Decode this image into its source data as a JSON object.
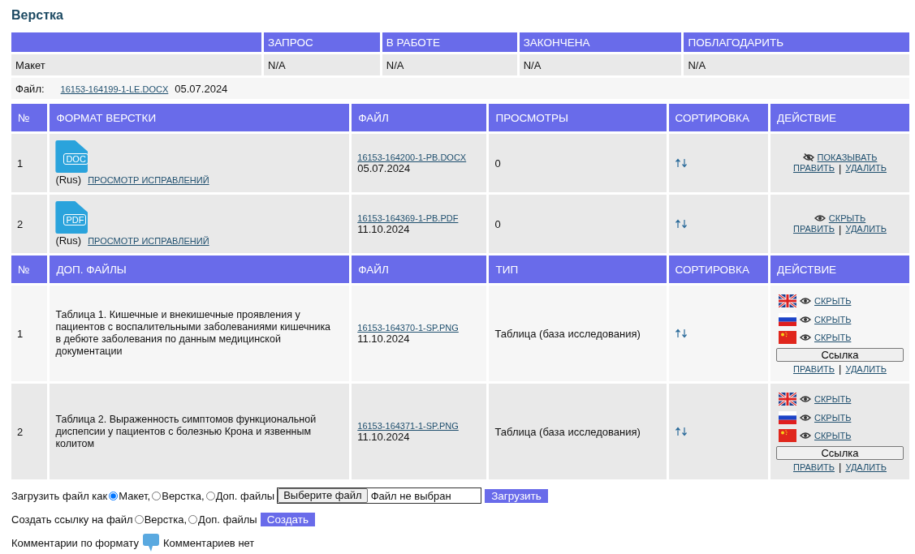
{
  "title": "Верстка",
  "status_table": {
    "columns": [
      "ЗАПРОС",
      "В РАБОТЕ",
      "ЗАКОНЧЕНА",
      "ПОБЛАГОДАРИТЬ"
    ],
    "rows": [
      {
        "label": "Макет",
        "cells": [
          "N/A",
          "N/A",
          "N/A",
          "N/A"
        ]
      }
    ],
    "file": {
      "label": "Файл:",
      "link": "16153-164199-1-LE.DOCX",
      "date": "05.07.2024"
    }
  },
  "layout_table": {
    "columns": [
      "№",
      "ФОРМАТ ВЕРСТКИ",
      "ФАЙЛ",
      "ПРОСМОТРЫ",
      "СОРТИРОВКА",
      "ДЕЙСТВИЕ"
    ],
    "rows": [
      {
        "number": "1",
        "file_type": "DOC",
        "language": "(Rus)",
        "changes_link": "ПРОСМОТР ИСПРАВЛЕНИЙ",
        "file_link": "16153-164200-1-PB.DOCX",
        "date": "05.07.2024",
        "views": "0",
        "eye_crossed": true,
        "visibility_link": "ПОКАЗЫВАТЬ",
        "edit": "ПРАВИТЬ",
        "separator": "|",
        "delete": "УДАЛИТЬ"
      },
      {
        "number": "2",
        "file_type": "PDF",
        "language": "(Rus)",
        "changes_link": "ПРОСМОТР ИСПРАВЛЕНИЙ",
        "file_link": "16153-164369-1-PB.PDF",
        "date": "11.10.2024",
        "views": "0",
        "eye_crossed": false,
        "visibility_link": "СКРЫТЬ",
        "edit": "ПРАВИТЬ",
        "separator": "|",
        "delete": "УДАЛИТЬ"
      }
    ]
  },
  "extra_table": {
    "columns": [
      "№",
      "ДОП. ФАЙЛЫ",
      "ФАЙЛ",
      "ТИП",
      "СОРТИРОВКА",
      "ДЕЙСТВИЕ"
    ],
    "rows": [
      {
        "number": "1",
        "description": "Таблица 1. Кишечные и внекишечные проявления у пациентов с воспалительными заболеваниями кишечника в дебюте заболевания по данным медицинской документации",
        "file_link": "16153-164370-1-SP.PNG",
        "date": "11.10.2024",
        "type": "Таблица (база исследования)",
        "translations": [
          {
            "kind": "uk",
            "eye_crossed": false,
            "link": "СКРЫТЬ"
          },
          {
            "kind": "ru",
            "eye_crossed": false,
            "link": "СКРЫТЬ"
          },
          {
            "kind": "cn",
            "eye_crossed": false,
            "link": "СКРЫТЬ"
          }
        ],
        "link_button": "Ссылка",
        "edit": "ПРАВИТЬ",
        "separator": "|",
        "delete": "УДАЛИТЬ"
      },
      {
        "number": "2",
        "description": "Таблица 2. Выраженность симптомов функциональной диспепсии у пациентов с болезнью Крона и язвенным колитом",
        "file_link": "16153-164371-1-SP.PNG",
        "date": "11.10.2024",
        "type": "Таблица (база исследования)",
        "translations": [
          {
            "kind": "uk",
            "eye_crossed": false,
            "link": "СКРЫТЬ"
          },
          {
            "kind": "ru",
            "eye_crossed": false,
            "link": "СКРЫТЬ"
          },
          {
            "kind": "cn",
            "eye_crossed": false,
            "link": "СКРЫТЬ"
          }
        ],
        "link_button": "Ссылка",
        "edit": "ПРАВИТЬ",
        "separator": "|",
        "delete": "УДАЛИТЬ"
      }
    ]
  },
  "upload_form": {
    "label": "Загрузить файл как",
    "radios": [
      {
        "label": "Макет,",
        "selected": true
      },
      {
        "label": "Верстка,",
        "selected": false
      },
      {
        "label": "Доп. файлы",
        "selected": false
      }
    ],
    "choose_button": "Выберите файл",
    "file_status": "Файл не выбран",
    "submit": "Загрузить"
  },
  "link_form": {
    "label": "Создать ссылку на файл",
    "radios": [
      {
        "label": "Верстка,",
        "selected": false
      },
      {
        "label": "Доп. файлы",
        "selected": false
      }
    ],
    "submit": "Создать"
  },
  "comments": {
    "label": "Комментарии по формату",
    "text": "Комментариев нет"
  }
}
